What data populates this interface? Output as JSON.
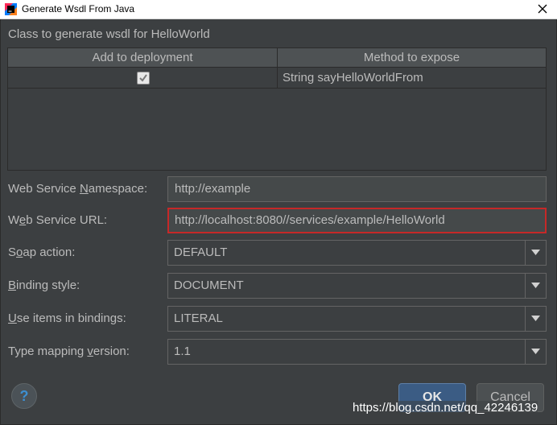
{
  "window": {
    "title": "Generate Wsdl From Java",
    "icon": "intellij-icon",
    "close_icon": "close-icon"
  },
  "section_title": "Class to generate wsdl for HelloWorld",
  "table": {
    "columns": [
      "Add to deployment",
      "Method to expose"
    ],
    "rows": [
      {
        "checked": true,
        "method": "String sayHelloWorldFrom"
      }
    ]
  },
  "form": {
    "namespace": {
      "label": "Web Service Namespace:",
      "mnemonic": "N",
      "value": "http://example"
    },
    "url": {
      "label": "Web Service URL:",
      "mnemonic": "e",
      "value": "http://localhost:8080//services/example/HelloWorld"
    },
    "soap_action": {
      "label": "Soap action:",
      "mnemonic": "o",
      "value": "DEFAULT"
    },
    "binding_style": {
      "label": "Binding style:",
      "mnemonic": "B",
      "value": "DOCUMENT"
    },
    "use_items": {
      "label": "Use items in bindings:",
      "mnemonic": "U",
      "value": "LITERAL"
    },
    "type_mapping": {
      "label": "Type mapping version:",
      "mnemonic": "v",
      "value": "1.1"
    }
  },
  "buttons": {
    "help": "?",
    "ok": "OK",
    "cancel": "Cancel"
  },
  "watermark": "https://blog.csdn.net/qq_42246139",
  "colors": {
    "background": "#3c3f41",
    "highlight_border": "#c62828",
    "ok_button": "#3b5c84",
    "help_icon": "#3d8fd1"
  }
}
